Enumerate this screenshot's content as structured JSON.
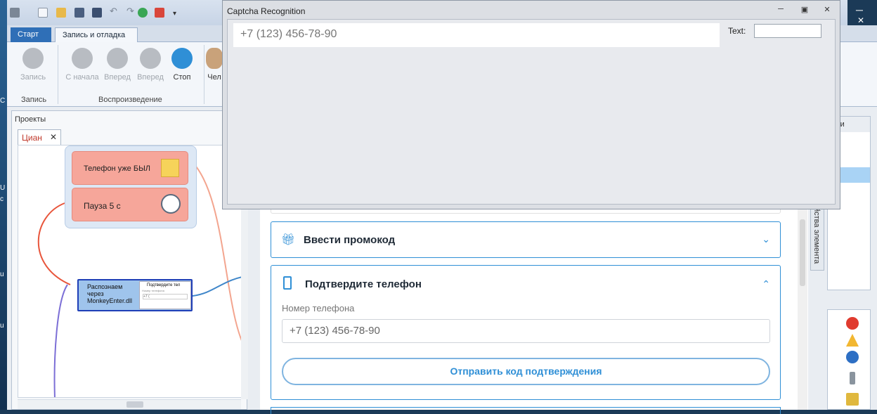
{
  "desktop": {
    "left_labels": [
      "C",
      "U",
      "с",
      "u",
      "u"
    ]
  },
  "ribbon": {
    "tabs": [
      "Старт",
      "Запись и отладка"
    ],
    "buttons": {
      "record": "Запись",
      "from_start": "С начала",
      "forward": "Вперед",
      "forward2": "Вперед",
      "stop": "Стоп",
      "partial": "Чел"
    },
    "groups": {
      "record": "Запись",
      "playback": "Воспроизведение"
    }
  },
  "projects": {
    "title": "Проекты",
    "tab": "Циан",
    "close_glyph": "✕",
    "nodes": {
      "phone_was": "Телефон уже БЫЛ",
      "pause": "Пауза 5 с",
      "recognize_lines": [
        "Распознаем",
        "через",
        "MonkeyEnter.dll"
      ],
      "thumb_title": "Подтвердите тел",
      "thumb_sub": "Номер телефона",
      "thumb_input": "+7 ("
    }
  },
  "captcha": {
    "title": "Captcha Recognition",
    "value": "+7 (123) 456-78-90",
    "text_label": "Text:",
    "text_value": ""
  },
  "web": {
    "promo": "Ввести промокод",
    "confirm": "Подтвердите телефон",
    "phone_label": "Номер телефона",
    "phone_value": "+7 (123) 456-78-90",
    "send_button": "Отправить код подтверждения"
  },
  "right_panel": {
    "header": "етки",
    "vertical_tab": "йства элемента"
  },
  "colors": {
    "accent": "#2f8fd6",
    "node_red": "#f6a69a",
    "node_blue": "#9fc4ec",
    "tab_blue": "#2f6fb7"
  }
}
